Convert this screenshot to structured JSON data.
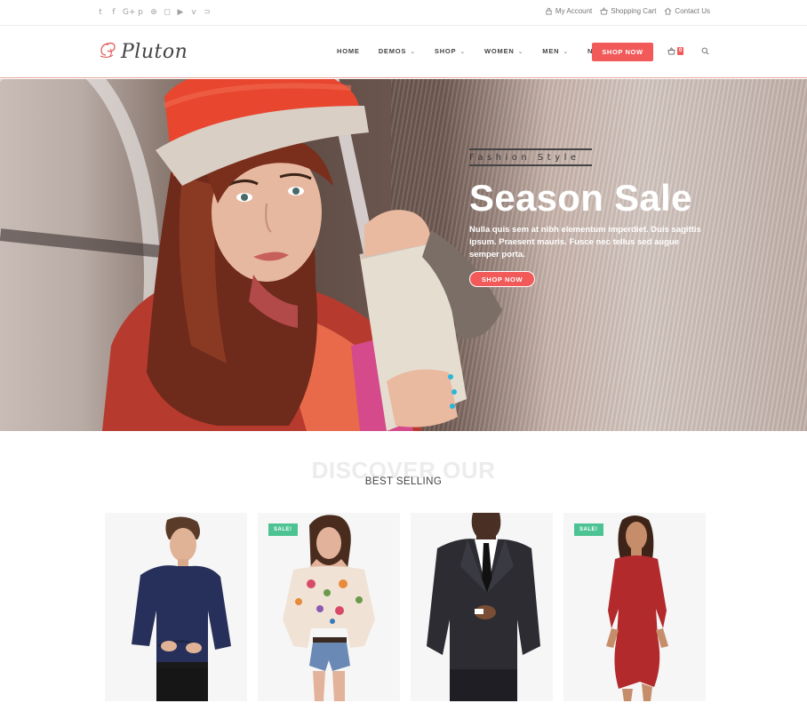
{
  "topbar": {
    "social_icons": [
      "twitter-icon",
      "facebook-icon",
      "google-plus-icon",
      "pinterest-icon",
      "dribbble-icon",
      "instagram-icon",
      "youtube-icon",
      "vimeo-icon",
      "rss-icon"
    ],
    "social_glyphs": [
      "t",
      "f",
      "G+",
      "p",
      "⊛",
      "◻",
      "▶",
      "v",
      "⊃"
    ],
    "links": [
      {
        "label": "My Account",
        "icon": "lock-icon"
      },
      {
        "label": "Shopping Cart",
        "icon": "basket-icon"
      },
      {
        "label": "Contact Us",
        "icon": "home-icon"
      }
    ]
  },
  "header": {
    "logo_text": "Pluton",
    "nav": [
      {
        "label": "HOME",
        "dropdown": false
      },
      {
        "label": "DEMOS",
        "dropdown": true
      },
      {
        "label": "SHOP",
        "dropdown": true
      },
      {
        "label": "WOMEN",
        "dropdown": true
      },
      {
        "label": "MEN",
        "dropdown": true
      },
      {
        "label": "NEWS",
        "dropdown": false
      }
    ],
    "cta_label": "SHOP NOW",
    "cart_count": "0"
  },
  "hero": {
    "eyebrow": "Fashion Style",
    "title": "Season Sale",
    "description": "Nulla quis sem at nibh elementum imperdiet. Duis sagittis ipsum. Praesent mauris. Fusce nec tellus sed augue semper porta.",
    "button_label": "SHOP NOW"
  },
  "discover": {
    "heading": "DISCOVER OUR",
    "subheading": "BEST SELLING"
  },
  "products": [
    {
      "name": "product-card-men-shirt",
      "badge": ""
    },
    {
      "name": "product-card-floral-top",
      "badge": "SALE!"
    },
    {
      "name": "product-card-men-suit",
      "badge": ""
    },
    {
      "name": "product-card-red-dress",
      "badge": "SALE!"
    }
  ],
  "colors": {
    "accent": "#f25a5a",
    "sale_badge": "#4dc394",
    "text_dark": "#444444"
  }
}
